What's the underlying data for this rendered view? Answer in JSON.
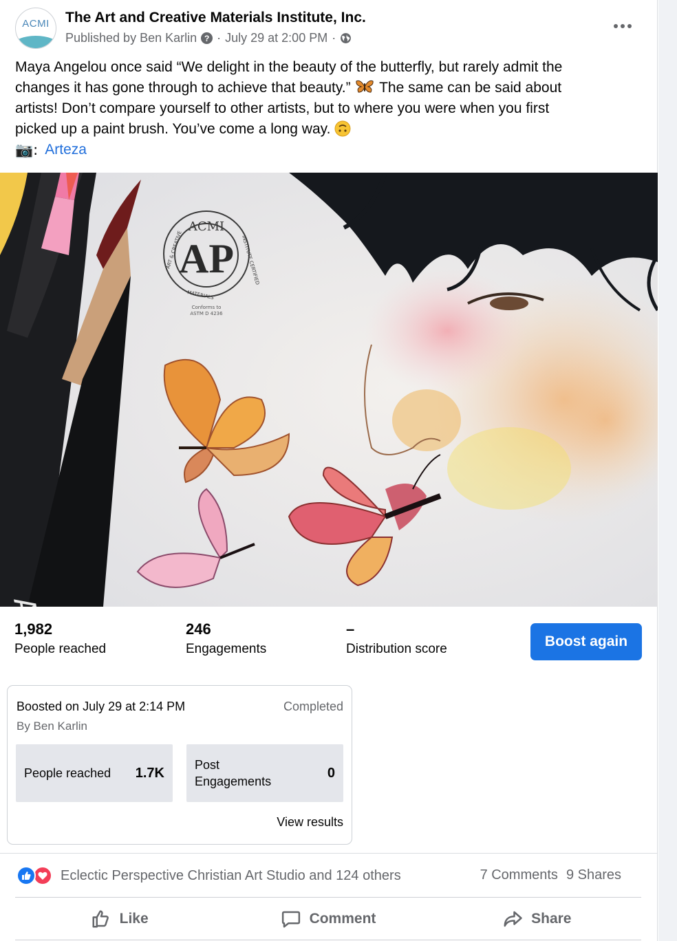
{
  "post": {
    "page_name": "The Art and Creative Materials Institute, Inc.",
    "avatar_text": "ACMI",
    "published_by": "Published by Ben Karlin",
    "separator": "·",
    "timestamp": "July 29 at 2:00 PM",
    "text_line1": "Maya Angelou once said “We delight in the beauty of the butterfly, but rarely admit the",
    "text_line2_a": "changes it has gone through to achieve that beauty.”",
    "text_line2_b": " The same can be said about",
    "text_line3": "artists! Don’t compare yourself to other artists, but to where you were when you first",
    "text_line4": "picked up a paint brush. You’ve come a long way.",
    "credit_prefix": "📷:",
    "credit_link": "Arteza"
  },
  "image": {
    "seal_top": "ACMI",
    "seal_center": "AP",
    "seal_ring_left": "ART & CREATIVE",
    "seal_ring_right": "INSTITUTE CERTIFIED",
    "seal_ring_bottom": "MATERIALS",
    "seal_note1": "Conforms to",
    "seal_note2": "ASTM D 4236",
    "pen_brand": "ARTE"
  },
  "stats": [
    {
      "value": "1,982",
      "label": "People reached"
    },
    {
      "value": "246",
      "label": "Engagements"
    },
    {
      "value": "–",
      "label": "Distribution score"
    }
  ],
  "boost_button": "Boost again",
  "boost_box": {
    "title": "Boosted on July 29 at 2:14 PM",
    "status": "Completed",
    "by": "By Ben Karlin",
    "metric1_label": "People reached",
    "metric1_value": "1.7K",
    "metric2_label_a": "Post",
    "metric2_label_b": "Engagements",
    "metric2_value": "0",
    "view_results": "View results"
  },
  "reactions": {
    "text": "Eclectic Perspective Christian Art Studio and 124 others",
    "comments": "7 Comments",
    "shares": "9 Shares"
  },
  "actions": {
    "like": "Like",
    "comment": "Comment",
    "share": "Share"
  },
  "colors": {
    "link": "#216fdb",
    "button": "#1b74e4",
    "secondary_text": "#65676b",
    "like_reaction": "#1877f2",
    "love_reaction": "#f33e58"
  },
  "icons": [
    "help-icon",
    "globe-icon",
    "more-icon",
    "butterfly-emoji",
    "upside-down-face-emoji",
    "camera-emoji",
    "like-reaction-icon",
    "love-reaction-icon",
    "thumbs-up-icon",
    "comment-icon",
    "share-icon"
  ]
}
